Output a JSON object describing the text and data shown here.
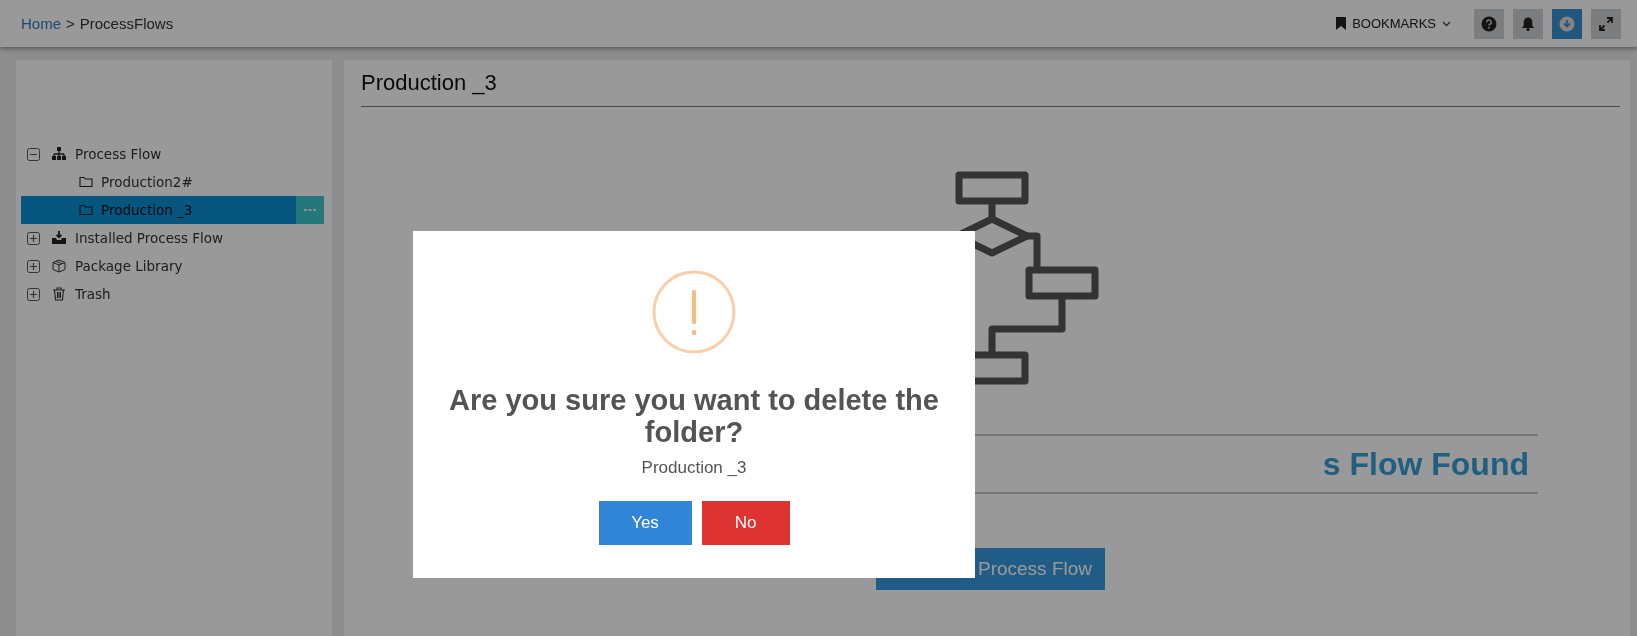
{
  "breadcrumb": {
    "link": "Home",
    "separator": ">",
    "current": "ProcessFlows"
  },
  "bookmarks": {
    "label": "BOOKMARKS"
  },
  "toolbar_buttons": [
    {
      "kind": "help",
      "highlighted": false
    },
    {
      "kind": "bell",
      "highlighted": false
    },
    {
      "kind": "download",
      "highlighted": true
    },
    {
      "kind": "expand",
      "highlighted": false
    }
  ],
  "tree": [
    {
      "kind": "hierarchy",
      "label": "Process Flow",
      "expanded": true,
      "selected": false,
      "children": [
        {
          "kind": "folder",
          "label": "Production2#",
          "selected": false
        },
        {
          "kind": "folder",
          "label": "Production _3",
          "selected": true
        }
      ]
    },
    {
      "kind": "inbox",
      "label": "Installed Process Flow",
      "expanded": false,
      "selected": false
    },
    {
      "kind": "box",
      "label": "Package Library",
      "expanded": false,
      "selected": false
    },
    {
      "kind": "trash",
      "label": "Trash",
      "expanded": false,
      "selected": false
    }
  ],
  "main": {
    "title": "Production _3",
    "empty_heading": "s Flow Found",
    "create_button": "Process Flow"
  },
  "dialog": {
    "title": "Are you sure you want to delete the folder?",
    "subject": "Production _3",
    "buttons": [
      {
        "kind": "confirm",
        "label": "Yes"
      },
      {
        "kind": "cancel",
        "label": "No"
      }
    ]
  }
}
